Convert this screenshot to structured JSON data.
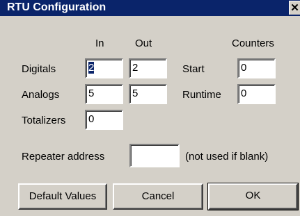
{
  "window": {
    "title": "RTU Configuration",
    "close_glyph": "✕",
    "close_icon": "close-icon"
  },
  "columns": {
    "in": "In",
    "out": "Out",
    "counters": "Counters"
  },
  "rows": {
    "digitals": {
      "label": "Digitals",
      "in": "2",
      "out": "2"
    },
    "analogs": {
      "label": "Analogs",
      "in": "5",
      "out": "5"
    },
    "totalizers": {
      "label": "Totalizers",
      "in": "0"
    }
  },
  "counters": {
    "start": {
      "label": "Start",
      "value": "0"
    },
    "runtime": {
      "label": "Runtime",
      "value": "0"
    }
  },
  "repeater": {
    "label": "Repeater address",
    "value": "",
    "note": "(not used if blank)"
  },
  "buttons": {
    "defaults": "Default Values",
    "cancel": "Cancel",
    "ok": "OK"
  },
  "colors": {
    "titlebar": "#0a246a",
    "face": "#d4d0c8"
  }
}
